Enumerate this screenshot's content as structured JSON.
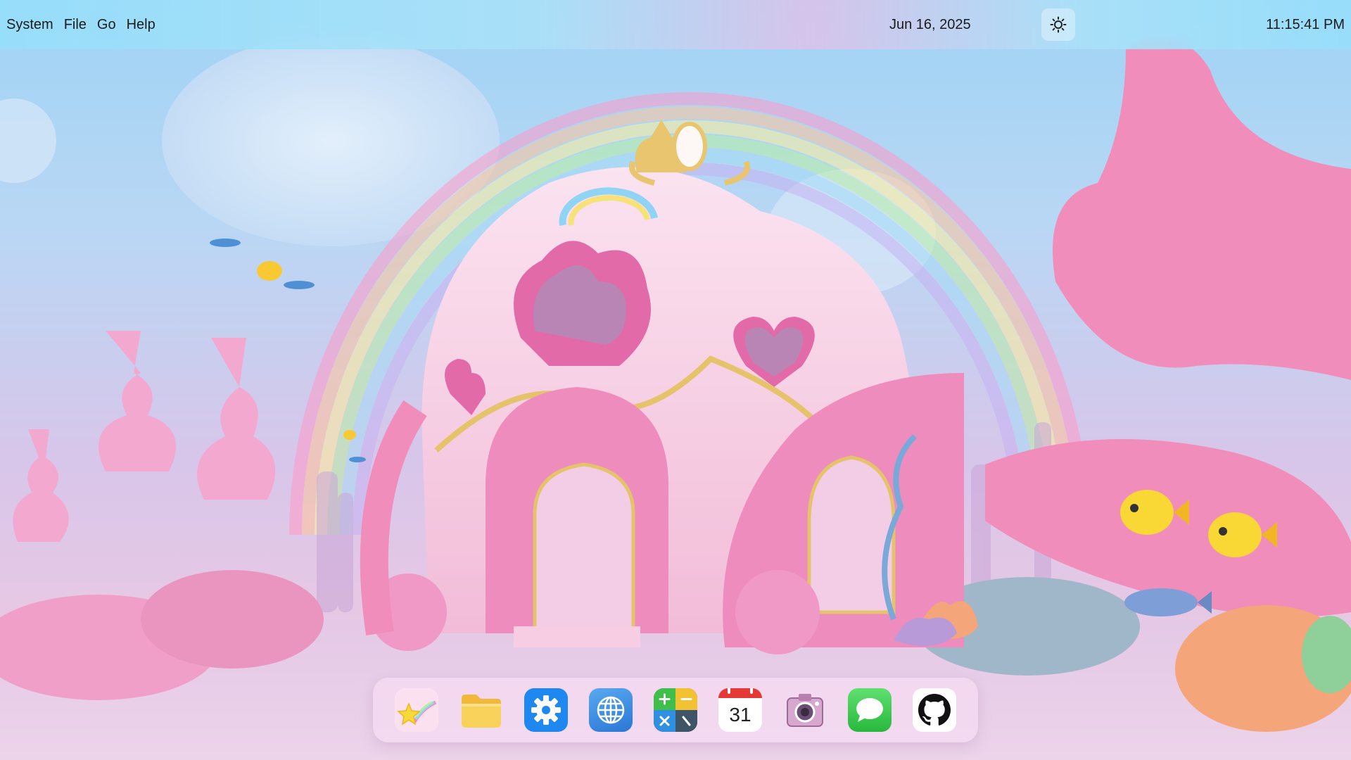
{
  "menubar": {
    "menus": [
      "System",
      "File",
      "Go",
      "Help"
    ],
    "date": "Jun 16, 2025",
    "time": "11:15:41 PM",
    "brightness_icon": "brightness-icon"
  },
  "dock": {
    "apps": [
      {
        "name": "launcher",
        "icon": "shooting-star-icon"
      },
      {
        "name": "files",
        "icon": "folder-icon"
      },
      {
        "name": "settings",
        "icon": "gear-icon"
      },
      {
        "name": "browser",
        "icon": "globe-icon"
      },
      {
        "name": "calculator",
        "icon": "calculator-icon"
      },
      {
        "name": "calendar",
        "icon": "calendar-icon",
        "day": "31"
      },
      {
        "name": "camera",
        "icon": "camera-icon"
      },
      {
        "name": "messages",
        "icon": "chat-bubble-icon"
      },
      {
        "name": "github",
        "icon": "github-icon"
      }
    ]
  },
  "colors": {
    "sky": "#9fd3f5",
    "pink": "#f08dbb",
    "dock_bg": "#f6dcf2",
    "settings_blue": "#1e88f0",
    "messages_green": "#34c84a"
  }
}
